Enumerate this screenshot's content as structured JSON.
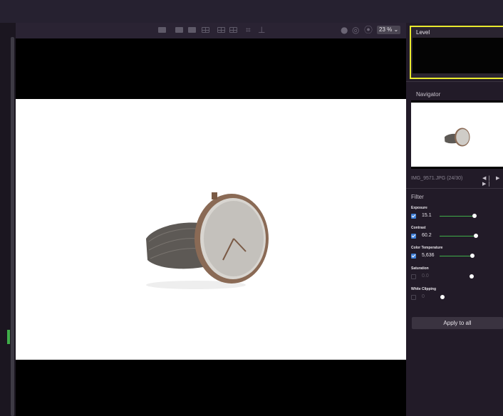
{
  "toolbar": {
    "icons": [
      "single-view-icon",
      "compare-view-icon",
      "side-by-side-icon",
      "split-view-icon",
      "grid-view-icon",
      "grid-large-icon",
      "crop-icon",
      "stamp-icon",
      "record-icon",
      "history-icon",
      "play-icon"
    ],
    "zoom_label": "23 % ⌄"
  },
  "level_panel": {
    "title": "Level"
  },
  "navigator": {
    "title": "Navigator",
    "file_name": "IMG_9571.JPG (24/30)",
    "nav_arrows": "◀|  ▶  ▶|"
  },
  "filter": {
    "title": "Filter",
    "items": [
      {
        "label": "Exposure",
        "value": "15.1",
        "enabled": true,
        "level": 0.55
      },
      {
        "label": "Contrast",
        "value": "60.2",
        "enabled": true,
        "level": 0.57
      },
      {
        "label": "Color Temperature",
        "value": "5,636",
        "enabled": true,
        "level": 0.52
      },
      {
        "label": "Saturation",
        "value": "0.0",
        "enabled": false,
        "level": 0.5
      },
      {
        "label": "White Clipping",
        "value": "0",
        "enabled": false,
        "level": 0.05
      }
    ],
    "apply_label": "Apply to all"
  },
  "colors": {
    "accent_green": "#3fae49",
    "level_border": "#e9ea2e",
    "checkbox_blue": "#3f7fd6"
  }
}
